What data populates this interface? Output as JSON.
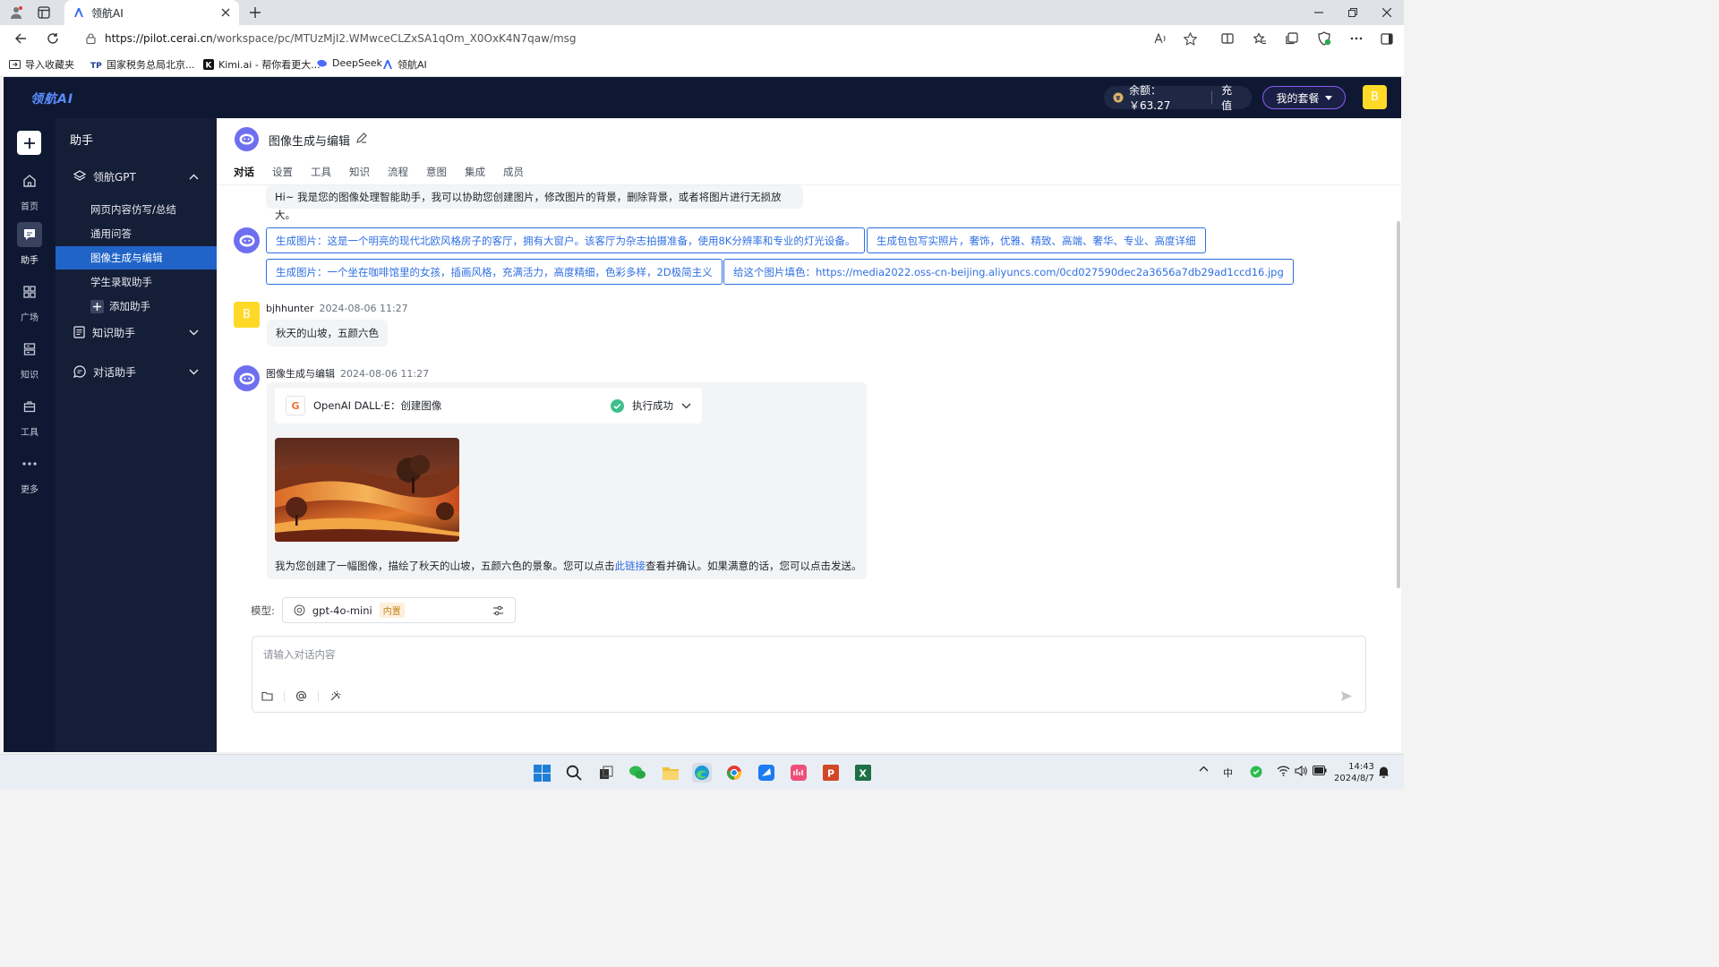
{
  "browser": {
    "tab_title": "领航AI",
    "url_host": "https://pilot.cerai.cn",
    "url_path": "/workspace/pc/MTUzMjI2.WMwceCLZxSA1qOm_X0OxK4N7qaw/msg",
    "bookmarks": [
      {
        "label": "导入收藏夹"
      },
      {
        "label": "国家税务总局北京..."
      },
      {
        "label": "Kimi.ai - 帮你看更大..."
      },
      {
        "label": "DeepSeek"
      },
      {
        "label": "领航AI"
      }
    ]
  },
  "header": {
    "logo": "领航AI",
    "balance_label": "余额：￥63.27",
    "recharge": "充值",
    "plan": "我的套餐",
    "avatar": "B"
  },
  "rail": {
    "items": [
      {
        "label": "首页",
        "icon": "home-icon"
      },
      {
        "label": "助手",
        "icon": "chat-icon"
      },
      {
        "label": "广场",
        "icon": "grid-icon"
      },
      {
        "label": "知识",
        "icon": "database-icon"
      },
      {
        "label": "工具",
        "icon": "toolbox-icon"
      },
      {
        "label": "更多",
        "icon": "more-icon"
      }
    ]
  },
  "sidebar": {
    "title": "助手",
    "group1": "领航GPT",
    "items": [
      {
        "label": "网页内容仿写/总结"
      },
      {
        "label": "通用问答"
      },
      {
        "label": "图像生成与编辑"
      },
      {
        "label": "学生录取助手"
      }
    ],
    "add": "添加助手",
    "group2": "知识助手",
    "group3": "对话助手"
  },
  "main": {
    "title": "图像生成与编辑",
    "tabs": [
      {
        "label": "对话"
      },
      {
        "label": "设置"
      },
      {
        "label": "工具"
      },
      {
        "label": "知识"
      },
      {
        "label": "流程"
      },
      {
        "label": "意图"
      },
      {
        "label": "集成"
      },
      {
        "label": "成员"
      }
    ],
    "greeting": "Hi~ 我是您的图像处理智能助手，我可以协助您创建图片，修改图片的背景，删除背景，或者将图片进行无损放大。",
    "suggestions": [
      "生成图片：这是一个明亮的现代北欧风格房子的客厅，拥有大窗户。该客厅为杂志拍摄准备，使用8K分辨率和专业的灯光设备。",
      "生成包包写实照片，奢饰，优雅、精致、高端、奢华、专业、高度详细",
      "生成图片：一个坐在咖啡馆里的女孩，插画风格，充满活力，高度精细，色彩多样，2D极简主义",
      "给这个图片填色：https://media2022.oss-cn-beijing.aliyuncs.com/0cd027590dec2a3656a7db29ad1ccd16.jpg"
    ],
    "user_msg": {
      "avatar": "B",
      "name": "bjhhunter",
      "time": "2024-08-06 11:27",
      "text": "秋天的山坡，五颜六色"
    },
    "bot_msg": {
      "name": "图像生成与编辑",
      "time": "2024-08-06 11:27",
      "tool_icon": "G",
      "tool_name": "OpenAI DALL·E：创建图像",
      "tool_status": "执行成功",
      "reply_before": "我为您创建了一幅图像，描绘了秋天的山坡，五颜六色的景象。您可以点击",
      "reply_link": "此链接",
      "reply_after": "查看并确认。如果满意的话，您可以点击发送。"
    },
    "model_label": "模型:",
    "model_name": "gpt-4o-mini",
    "model_tag": "内置",
    "input_placeholder": "请输入对话内容"
  },
  "taskbar": {
    "ime": "中",
    "time": "14:43",
    "date": "2024/8/7"
  },
  "colors": {
    "accent": "#2f6fe4",
    "nav_bg": "#0f1832",
    "sidebar_active": "#2064c8",
    "bot_avatar": "#6e6ff0",
    "user_avatar": "#ffd928",
    "success": "#3dbf8a"
  }
}
